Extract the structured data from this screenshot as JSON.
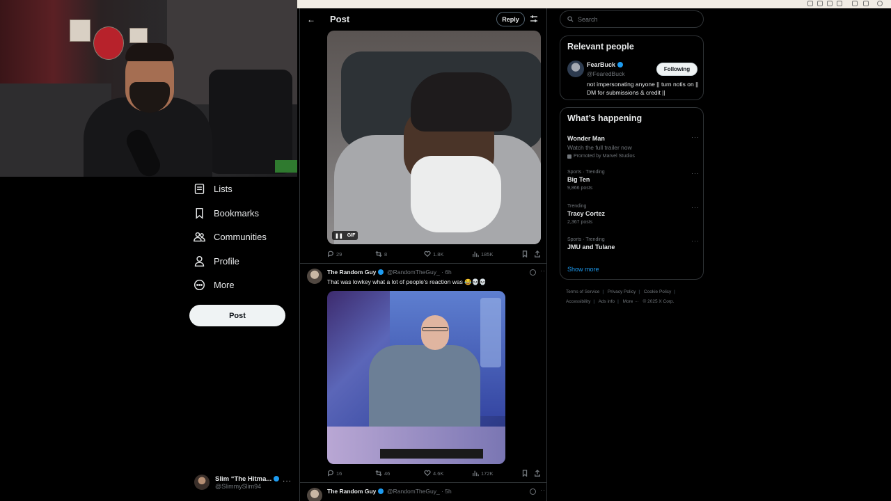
{
  "nav": {
    "items": [
      {
        "label": "Lists",
        "icon": "list-icon"
      },
      {
        "label": "Bookmarks",
        "icon": "bookmark-icon"
      },
      {
        "label": "Communities",
        "icon": "communities-icon"
      },
      {
        "label": "Profile",
        "icon": "profile-icon"
      },
      {
        "label": "More",
        "icon": "more-circle-icon"
      }
    ],
    "post_button": "Post"
  },
  "account": {
    "name": "Slim “The Hitma...",
    "handle": "@SlimmySlim94"
  },
  "header": {
    "title": "Post",
    "reply_button": "Reply"
  },
  "post1": {
    "gif_label": "GIF",
    "stats": {
      "replies": "29",
      "reposts": "8",
      "likes": "1.8K",
      "views": "185K"
    }
  },
  "post2": {
    "author": "The Random Guy",
    "handle_time": "@RandomTheGuy_ · 6h",
    "text": "That was lowkey what a lot of people's reaction was 😂💀💀",
    "stats": {
      "replies": "16",
      "reposts": "46",
      "likes": "4.6K",
      "views": "172K"
    }
  },
  "post3": {
    "author": "The Random Guy",
    "handle_time": "@RandomTheGuy_ · 5h"
  },
  "search": {
    "placeholder": "Search"
  },
  "relevant": {
    "heading": "Relevant people",
    "name": "FearBuck",
    "handle": "@FearedBuck",
    "follow_label": "Following",
    "bio": "not impersonating anyone || turn notis on || DM for submissions & credit ||"
  },
  "happening": {
    "heading": "What’s happening",
    "trends": [
      {
        "context": "",
        "title": "Wonder Man",
        "subtitle": "Watch the full trailer now",
        "promo": "Promoted by Marvel Studios",
        "count": ""
      },
      {
        "context": "Sports · Trending",
        "title": "Big Ten",
        "subtitle": "",
        "promo": "",
        "count": "9,866 posts"
      },
      {
        "context": "Trending",
        "title": "Tracy Cortez",
        "subtitle": "",
        "promo": "",
        "count": "2,367 posts"
      },
      {
        "context": "Sports · Trending",
        "title": "JMU and Tulane",
        "subtitle": "",
        "promo": "",
        "count": ""
      }
    ],
    "show_more": "Show more"
  },
  "footer": {
    "links": [
      "Terms of Service",
      "Privacy Policy",
      "Cookie Policy",
      "Accessibility",
      "Ads info",
      "More ···"
    ],
    "copyright": "© 2025 X Corp."
  },
  "colors": {
    "accent": "#1d9bf0",
    "background": "#000000",
    "border": "#2f3336",
    "muted": "#71767b"
  }
}
